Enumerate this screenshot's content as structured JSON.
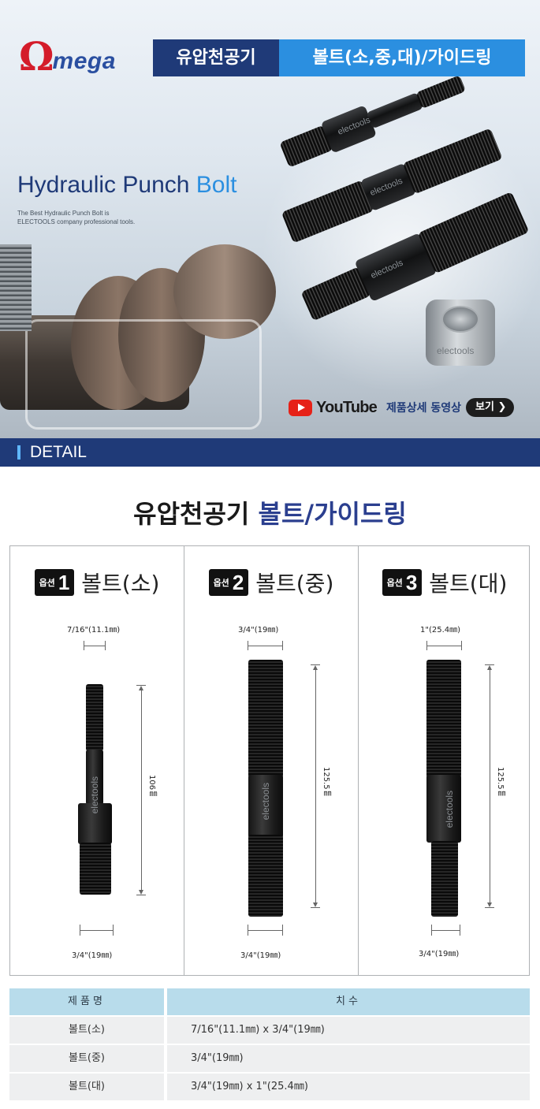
{
  "brand": {
    "logo_omega": "Ω",
    "logo_text": "mega"
  },
  "hero": {
    "title_part1": "유압천공기",
    "title_part2": "볼트(소,중,대)/가이드링",
    "heading_main": "Hydraulic Punch ",
    "heading_highlight": "Bolt",
    "subtext_line1": "The Best Hydraulic Punch Bolt is",
    "subtext_line2": "ELECTOOLS company professional tools.",
    "etch_label": "electools",
    "youtube_word": "YouTube",
    "video_text": "제품상세 동영상",
    "video_button": "보기 ❯"
  },
  "detail_bar": {
    "label": "DETAIL"
  },
  "section": {
    "title_main": "유압천공기 ",
    "title_highlight": "볼트/가이드링"
  },
  "options": [
    {
      "badge_label": "옵션",
      "badge_number": "1",
      "name": "볼트(소)",
      "top_dim": "7/16\"(11.1㎜)",
      "length": "106㎜",
      "bottom_dim": "3/4\"(19㎜)",
      "etch": "electools"
    },
    {
      "badge_label": "옵션",
      "badge_number": "2",
      "name": "볼트(중)",
      "top_dim": "3/4\"(19㎜)",
      "length": "125.5㎜",
      "bottom_dim": "3/4\"(19㎜)",
      "etch": "electools"
    },
    {
      "badge_label": "옵션",
      "badge_number": "3",
      "name": "볼트(대)",
      "top_dim": "1\"(25.4㎜)",
      "length": "125.5㎜",
      "bottom_dim": "3/4\"(19㎜)",
      "etch": "electools"
    }
  ],
  "spec_table": {
    "headers": [
      "제품명",
      "치수"
    ],
    "rows": [
      {
        "name": "볼트(소)",
        "size": "7/16\"(11.1㎜) x 3/4\"(19㎜)"
      },
      {
        "name": "볼트(중)",
        "size": "3/4\"(19㎜)"
      },
      {
        "name": "볼트(대)",
        "size": "3/4\"(19㎜) x 1\"(25.4㎜)"
      }
    ]
  },
  "colors": {
    "navy": "#1f3a78",
    "blue": "#2b8fe0",
    "logo_red": "#d41c2a",
    "table_header": "#b8dceb",
    "youtube_red": "#e62117"
  }
}
